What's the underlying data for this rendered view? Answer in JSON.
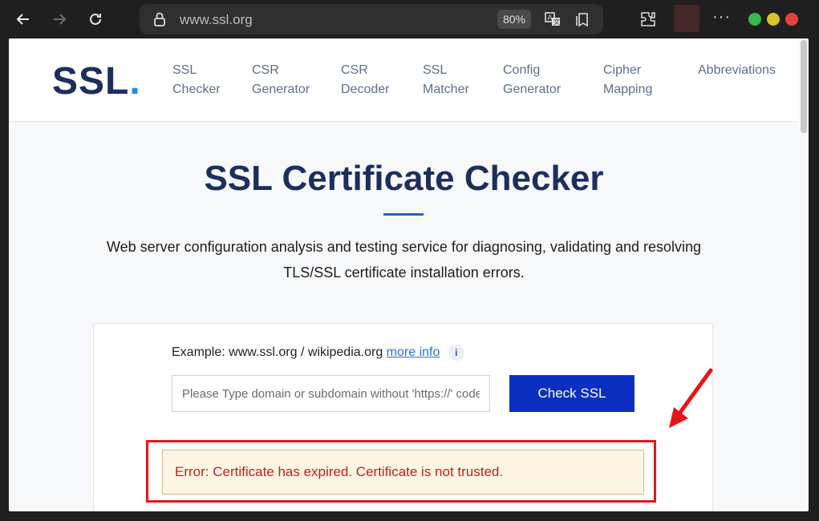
{
  "browser": {
    "url": "www.ssl.org",
    "zoom": "80%",
    "icons": [
      "back-arrow-icon",
      "forward-arrow-icon",
      "reload-icon",
      "lock-icon",
      "translate-icon",
      "reading-list-icon",
      "extensions-icon",
      "more-icon"
    ],
    "menu_dots": "···",
    "window_colors": {
      "min": "#3cb54a",
      "max": "#d8c22a",
      "close": "#e0443c"
    }
  },
  "site": {
    "logo_text": "SSL",
    "logo_dot": ".",
    "nav": [
      {
        "line1": "SSL",
        "line2": "Checker"
      },
      {
        "line1": "CSR",
        "line2": "Generator"
      },
      {
        "line1": "CSR",
        "line2": "Decoder"
      },
      {
        "line1": "SSL",
        "line2": "Matcher"
      },
      {
        "line1": "Config",
        "line2": "Generator"
      },
      {
        "line1": "Cipher",
        "line2": "Mapping"
      },
      {
        "line1": "Abbreviations",
        "line2": ""
      }
    ]
  },
  "hero": {
    "title": "SSL Certificate Checker",
    "description": "Web server configuration analysis and testing service for diagnosing, validating and resolving TLS/SSL certificate installation errors."
  },
  "form": {
    "example_prefix": "Example: www.ssl.org / wikipedia.org",
    "more_info": "more info",
    "info_glyph": "i",
    "placeholder": "Please Type domain or subdomain without 'https://' code",
    "value": "",
    "button_label": "Check SSL"
  },
  "result": {
    "error_message": "Error: Certificate has expired. Certificate is not trusted."
  },
  "colors": {
    "primary_button": "#0b2fc1",
    "logo": "#1c2f5c",
    "annotation": "#e8141a"
  }
}
